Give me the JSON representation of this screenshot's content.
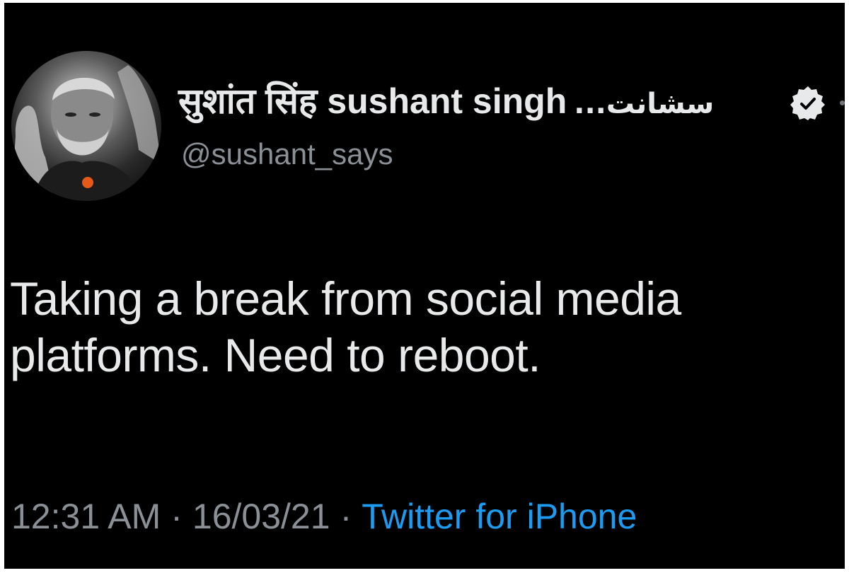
{
  "tweet": {
    "author": {
      "display_name": "सुशांत सिंह sushant singh",
      "display_name_suffix": "...سشانت",
      "handle": "@sushant_says",
      "verified": true,
      "verified_icon": "verified-badge-icon",
      "avatar": "profile-avatar"
    },
    "text_lines": [
      "Taking a break from social media",
      "platforms. Need to reboot."
    ],
    "time": "12:31 AM",
    "date": "16/03/21",
    "separator": "·",
    "source": "Twitter for iPhone"
  },
  "colors": {
    "background": "#000000",
    "primary_text": "#e7e9ea",
    "secondary_text": "#8b9096",
    "link": "#1d9bf0"
  }
}
